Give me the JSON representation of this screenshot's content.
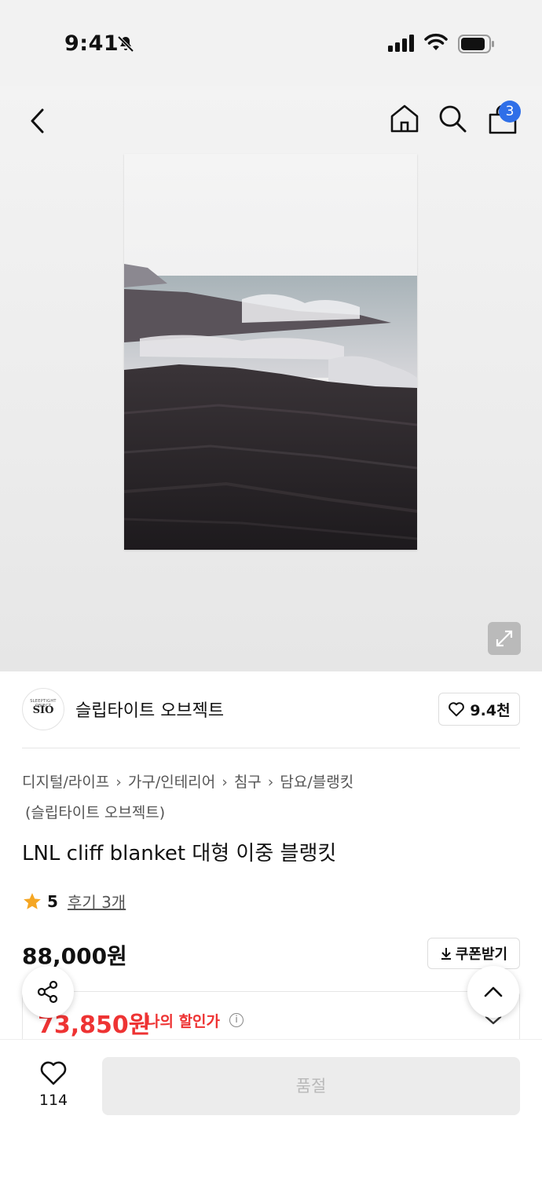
{
  "status_bar": {
    "time": "9:41"
  },
  "nav": {
    "cart_count": "3"
  },
  "brand": {
    "name": "슬립타이트 오브젝트",
    "logo_text_top": "SLEEPTIGHT OBJECT",
    "logo_text_main": "SIO",
    "likes": "9.4천"
  },
  "breadcrumb": {
    "items": [
      "디지털/라이프",
      "가구/인테리어",
      "침구",
      "담요/블랭킷"
    ],
    "brand_suffix": "(슬립타이트 오브젝트)"
  },
  "product": {
    "title": "LNL cliff blanket 대형 이중 블랭킷",
    "rating": "5",
    "reviews_label": "후기 3개",
    "price": "88,000원",
    "coupon_label": "쿠폰받기",
    "discount_price": "73,850원",
    "discount_label": "나의 할인가"
  },
  "bottom": {
    "wish_count": "114",
    "soldout_label": "품절"
  },
  "colors": {
    "accent_red": "#e33333",
    "badge_blue": "#2f6fe8",
    "star": "#f5a623"
  }
}
